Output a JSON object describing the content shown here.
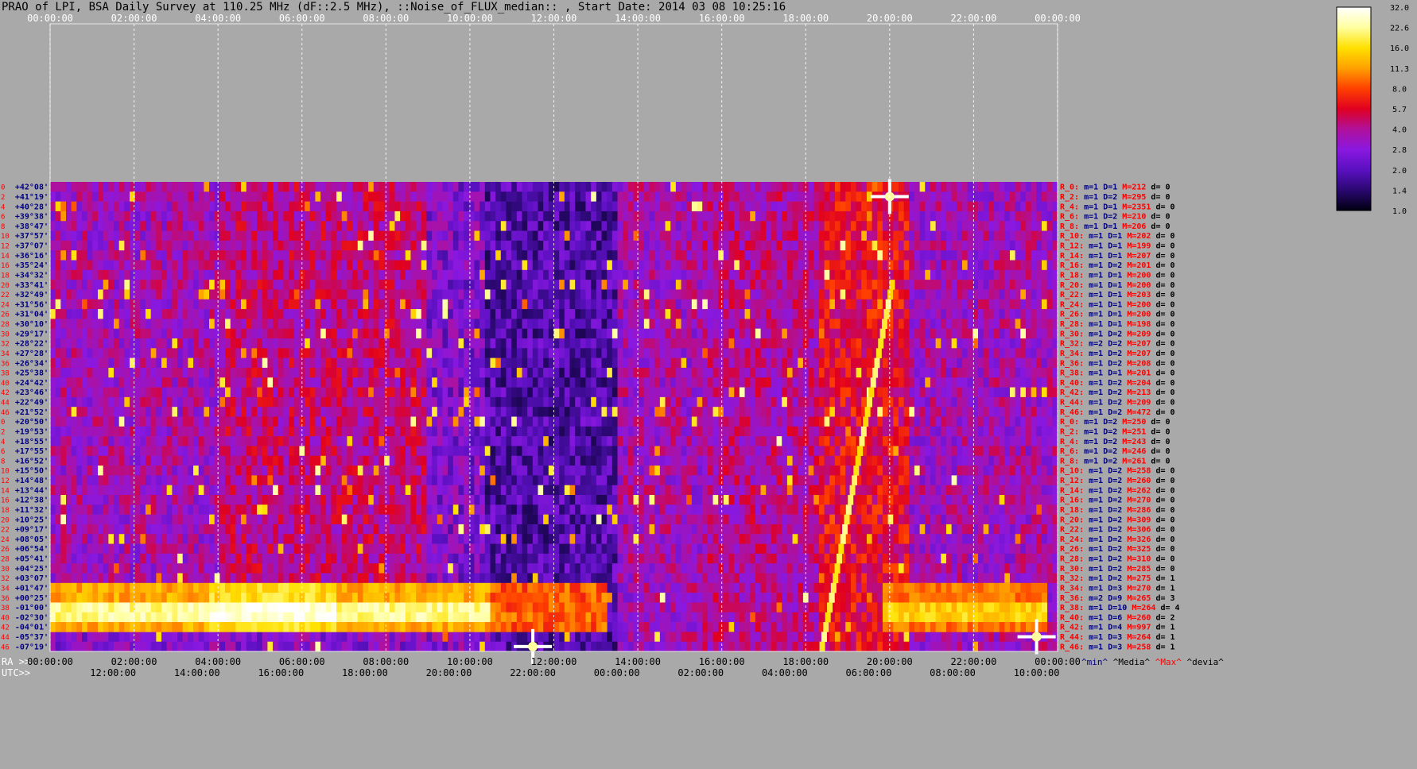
{
  "title": "PRAO of LPI, BSA Daily Survey at 110.25 MHz (dF::2.5 MHz), ::Noise_of_FLUX_median:: , Start Date: 2014 03 08 10:25:16",
  "top_axis": [
    "00:00:00",
    "02:00:00",
    "04:00:00",
    "06:00:00",
    "08:00:00",
    "10:00:00",
    "12:00:00",
    "14:00:00",
    "16:00:00",
    "18:00:00",
    "20:00:00",
    "22:00:00",
    "00:00:00"
  ],
  "ra_prefix": "RA >>",
  "ra_ticks": [
    "00:00:00",
    "02:00:00",
    "04:00:00",
    "06:00:00",
    "08:00:00",
    "10:00:00",
    "12:00:00",
    "14:00:00",
    "16:00:00",
    "18:00:00",
    "20:00:00",
    "22:00:00",
    "00:00:00"
  ],
  "utc_prefix": "UTC>>",
  "utc_ticks": [
    "12:00:00",
    "14:00:00",
    "16:00:00",
    "18:00:00",
    "20:00:00",
    "22:00:00",
    "00:00:00",
    "02:00:00",
    "04:00:00",
    "06:00:00",
    "08:00:00",
    "10:00:00"
  ],
  "row_index_labels": [
    "0",
    "2",
    "4",
    "6",
    "8",
    "10",
    "12",
    "14",
    "16",
    "18",
    "20",
    "22",
    "24",
    "26",
    "28",
    "30",
    "32",
    "34",
    "36",
    "38",
    "40",
    "42",
    "44",
    "46",
    "0",
    "2",
    "4",
    "6",
    "8",
    "10",
    "12",
    "14",
    "16",
    "18",
    "20",
    "22",
    "24",
    "26",
    "28",
    "30",
    "32",
    "34",
    "36",
    "38",
    "40",
    "42",
    "44",
    "46"
  ],
  "declinations": [
    "+42°08'",
    "+41°19'",
    "+40°28'",
    "+39°38'",
    "+38°47'",
    "+37°57'",
    "+37°07'",
    "+36°16'",
    "+35°24'",
    "+34°32'",
    "+33°41'",
    "+32°49'",
    "+31°56'",
    "+31°04'",
    "+30°10'",
    "+29°17'",
    "+28°22'",
    "+27°28'",
    "+26°34'",
    "+25°38'",
    "+24°42'",
    "+23°46'",
    "+22°49'",
    "+21°52'",
    "+20°50'",
    "+19°53'",
    "+18°55'",
    "+17°55'",
    "+16°52'",
    "+15°50'",
    "+14°48'",
    "+13°44'",
    "+12°38'",
    "+11°32'",
    "+10°25'",
    "+09°17'",
    "+08°05'",
    "+06°54'",
    "+05°41'",
    "+04°25'",
    "+03°07'",
    "+01°47'",
    "+00°25'",
    "-01°00'",
    "-02°30'",
    "-04°01'",
    "-05°37'",
    "-07°19'"
  ],
  "beam_stats": [
    {
      "r": "R_0:",
      "m": "m=1",
      "D": "D=1",
      "M": "M=212",
      "d": "d= 0"
    },
    {
      "r": "R_2:",
      "m": "m=1",
      "D": "D=2",
      "M": "M=295",
      "d": "d= 0"
    },
    {
      "r": "R_4:",
      "m": "m=1",
      "D": "D=1",
      "M": "M=2351",
      "d": "d= 0"
    },
    {
      "r": "R_6:",
      "m": "m=1",
      "D": "D=2",
      "M": "M=210",
      "d": "d= 0"
    },
    {
      "r": "R_8:",
      "m": "m=1",
      "D": "D=1",
      "M": "M=206",
      "d": "d= 0"
    },
    {
      "r": "R_10:",
      "m": "m=1",
      "D": "D=1",
      "M": "M=202",
      "d": "d= 0"
    },
    {
      "r": "R_12:",
      "m": "m=1",
      "D": "D=1",
      "M": "M=199",
      "d": "d= 0"
    },
    {
      "r": "R_14:",
      "m": "m=1",
      "D": "D=1",
      "M": "M=207",
      "d": "d= 0"
    },
    {
      "r": "R_16:",
      "m": "m=1",
      "D": "D=2",
      "M": "M=201",
      "d": "d= 0"
    },
    {
      "r": "R_18:",
      "m": "m=1",
      "D": "D=1",
      "M": "M=200",
      "d": "d= 0"
    },
    {
      "r": "R_20:",
      "m": "m=1",
      "D": "D=1",
      "M": "M=200",
      "d": "d= 0"
    },
    {
      "r": "R_22:",
      "m": "m=1",
      "D": "D=1",
      "M": "M=203",
      "d": "d= 0"
    },
    {
      "r": "R_24:",
      "m": "m=1",
      "D": "D=1",
      "M": "M=200",
      "d": "d= 0"
    },
    {
      "r": "R_26:",
      "m": "m=1",
      "D": "D=1",
      "M": "M=200",
      "d": "d= 0"
    },
    {
      "r": "R_28:",
      "m": "m=1",
      "D": "D=1",
      "M": "M=198",
      "d": "d= 0"
    },
    {
      "r": "R_30:",
      "m": "m=1",
      "D": "D=2",
      "M": "M=209",
      "d": "d= 0"
    },
    {
      "r": "R_32:",
      "m": "m=2",
      "D": "D=2",
      "M": "M=207",
      "d": "d= 0"
    },
    {
      "r": "R_34:",
      "m": "m=1",
      "D": "D=2",
      "M": "M=207",
      "d": "d= 0"
    },
    {
      "r": "R_36:",
      "m": "m=1",
      "D": "D=2",
      "M": "M=208",
      "d": "d= 0"
    },
    {
      "r": "R_38:",
      "m": "m=1",
      "D": "D=1",
      "M": "M=201",
      "d": "d= 0"
    },
    {
      "r": "R_40:",
      "m": "m=1",
      "D": "D=2",
      "M": "M=204",
      "d": "d= 0"
    },
    {
      "r": "R_42:",
      "m": "m=1",
      "D": "D=2",
      "M": "M=213",
      "d": "d= 0"
    },
    {
      "r": "R_44:",
      "m": "m=1",
      "D": "D=2",
      "M": "M=209",
      "d": "d= 0"
    },
    {
      "r": "R_46:",
      "m": "m=1",
      "D": "D=2",
      "M": "M=472",
      "d": "d= 0"
    },
    {
      "r": "R_0:",
      "m": "m=1",
      "D": "D=2",
      "M": "M=250",
      "d": "d= 0"
    },
    {
      "r": "R_2:",
      "m": "m=1",
      "D": "D=2",
      "M": "M=251",
      "d": "d= 0"
    },
    {
      "r": "R_4:",
      "m": "m=1",
      "D": "D=2",
      "M": "M=243",
      "d": "d= 0"
    },
    {
      "r": "R_6:",
      "m": "m=1",
      "D": "D=2",
      "M": "M=246",
      "d": "d= 0"
    },
    {
      "r": "R_8:",
      "m": "m=1",
      "D": "D=2",
      "M": "M=261",
      "d": "d= 0"
    },
    {
      "r": "R_10:",
      "m": "m=1",
      "D": "D=2",
      "M": "M=258",
      "d": "d= 0"
    },
    {
      "r": "R_12:",
      "m": "m=1",
      "D": "D=2",
      "M": "M=260",
      "d": "d= 0"
    },
    {
      "r": "R_14:",
      "m": "m=1",
      "D": "D=2",
      "M": "M=262",
      "d": "d= 0"
    },
    {
      "r": "R_16:",
      "m": "m=1",
      "D": "D=2",
      "M": "M=270",
      "d": "d= 0"
    },
    {
      "r": "R_18:",
      "m": "m=1",
      "D": "D=2",
      "M": "M=286",
      "d": "d= 0"
    },
    {
      "r": "R_20:",
      "m": "m=1",
      "D": "D=2",
      "M": "M=309",
      "d": "d= 0"
    },
    {
      "r": "R_22:",
      "m": "m=1",
      "D": "D=2",
      "M": "M=306",
      "d": "d= 0"
    },
    {
      "r": "R_24:",
      "m": "m=1",
      "D": "D=2",
      "M": "M=326",
      "d": "d= 0"
    },
    {
      "r": "R_26:",
      "m": "m=1",
      "D": "D=2",
      "M": "M=325",
      "d": "d= 0"
    },
    {
      "r": "R_28:",
      "m": "m=1",
      "D": "D=2",
      "M": "M=310",
      "d": "d= 0"
    },
    {
      "r": "R_30:",
      "m": "m=1",
      "D": "D=2",
      "M": "M=285",
      "d": "d= 0"
    },
    {
      "r": "R_32:",
      "m": "m=1",
      "D": "D=2",
      "M": "M=275",
      "d": "d= 1"
    },
    {
      "r": "R_34:",
      "m": "m=1",
      "D": "D=3",
      "M": "M=270",
      "d": "d= 1"
    },
    {
      "r": "R_36:",
      "m": "m=2",
      "D": "D=9",
      "M": "M=265",
      "d": "d= 3"
    },
    {
      "r": "R_38:",
      "m": "m=1",
      "D": "D=10",
      "M": "M=264",
      "d": "d= 4"
    },
    {
      "r": "R_40:",
      "m": "m=1",
      "D": "D=6",
      "M": "M=260",
      "d": "d= 2"
    },
    {
      "r": "R_42:",
      "m": "m=1",
      "D": "D=4",
      "M": "M=997",
      "d": "d= 1"
    },
    {
      "r": "R_44:",
      "m": "m=1",
      "D": "D=3",
      "M": "M=264",
      "d": "d= 1"
    },
    {
      "r": "R_46:",
      "m": "m=1",
      "D": "D=3",
      "M": "M=258",
      "d": "d= 1"
    }
  ],
  "stats_legend": {
    "min": "^min^",
    "media": "^Media^",
    "max": "^Max^",
    "devia": "^devia^"
  },
  "colorbar": {
    "ticks": [
      "32.0",
      "22.6",
      "16.0",
      "11.3",
      "8.0",
      "5.7",
      "4.0",
      "2.8",
      "2.0",
      "1.4",
      "1.0"
    ],
    "stops": [
      "#ffffff",
      "#ffffa0",
      "#ffe000",
      "#ffa000",
      "#ff4000",
      "#e00020",
      "#b0109a",
      "#8a18e0",
      "#5a10c0",
      "#2a0870",
      "#000010"
    ]
  },
  "colors": {
    "background": "#a9a9a9",
    "red_text": "#ff0000",
    "blue_text": "#000080",
    "grid_line": "#ffffff"
  },
  "chart_data": {
    "type": "heatmap",
    "title": "PRAO of LPI, BSA Daily Survey at 110.25 MHz (dF::2.5 MHz), ::Noise_of_FLUX_median:: , Start Date: 2014 03 08 10:25:16",
    "x_axis_ra": [
      "00:00:00",
      "02:00:00",
      "04:00:00",
      "06:00:00",
      "08:00:00",
      "10:00:00",
      "12:00:00",
      "14:00:00",
      "16:00:00",
      "18:00:00",
      "20:00:00",
      "22:00:00",
      "00:00:00"
    ],
    "x_axis_utc": [
      "12:00:00",
      "14:00:00",
      "16:00:00",
      "18:00:00",
      "20:00:00",
      "22:00:00",
      "00:00:00",
      "02:00:00",
      "04:00:00",
      "06:00:00",
      "08:00:00",
      "10:00:00"
    ],
    "y_axis_dec": "+42°08' to -07°19' (48 beams)",
    "color_scale": "log, 1.0 to 32.0",
    "features": [
      {
        "desc": "bright horizontal band at low declinations",
        "dec_range": "+01°47' to -04°01'",
        "ra_range_h": [
          0,
          10.5
        ],
        "level": 32
      },
      {
        "desc": "bright source",
        "ra_h": 20.0,
        "dec": "+41°19'",
        "level": 32
      },
      {
        "desc": "bright source",
        "ra_h": 11.5,
        "dec": "-07°19'",
        "level": 32
      },
      {
        "desc": "bright source",
        "ra_h": 23.5,
        "dec": "-05°37'",
        "level": 32
      },
      {
        "desc": "diagonal bright streak",
        "ra_h_range": [
          18.5,
          20.0
        ]
      }
    ]
  }
}
